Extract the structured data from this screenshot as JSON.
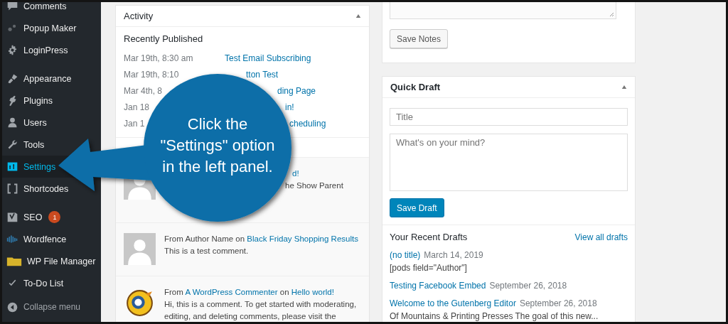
{
  "sidebar": {
    "groups": [
      {
        "items": [
          {
            "label": "Comments",
            "selected": false
          },
          {
            "label": "Popup Maker",
            "selected": false
          },
          {
            "label": "LoginPress",
            "selected": false
          }
        ]
      },
      {
        "items": [
          {
            "label": "Appearance",
            "selected": false
          },
          {
            "label": "Plugins",
            "selected": false
          },
          {
            "label": "Users",
            "selected": false
          },
          {
            "label": "Tools",
            "selected": false
          },
          {
            "label": "Settings",
            "selected": true
          },
          {
            "label": "Shortcodes",
            "selected": false
          }
        ]
      },
      {
        "items": [
          {
            "label": "SEO",
            "selected": false,
            "badge": "1"
          },
          {
            "label": "Wordfence",
            "selected": false
          },
          {
            "label": "WP File Manager",
            "selected": false
          },
          {
            "label": "To-Do List",
            "selected": false
          }
        ]
      }
    ],
    "collapse": {
      "label": "Collapse menu"
    }
  },
  "activity": {
    "title": "Activity",
    "section": "Recently Published",
    "published": [
      {
        "date": "Mar 19th, 8:30 am",
        "title": "Test Email Subscribing"
      },
      {
        "date": "Mar 19th, 8:10",
        "title": "tton Test"
      },
      {
        "date": "Mar 4th, 8",
        "title": "ding Page"
      },
      {
        "date": "Jan 18",
        "title": "in!"
      },
      {
        "date": "Jan 1",
        "title": "cheduling"
      }
    ],
    "comments": [
      {
        "kind": "default",
        "header": [
          {
            "text": "d!",
            "link": true
          }
        ],
        "body": "he Show Parent"
      },
      {
        "kind": "default",
        "header": [
          {
            "text": "From Author Name on",
            "link": false
          },
          {
            "text": "Black Friday Shopping Results",
            "link": true
          }
        ],
        "body": "This is a test comment."
      },
      {
        "kind": "mascot",
        "header": [
          {
            "text": "From",
            "link": false
          },
          {
            "text": "A WordPress Commenter",
            "link": true
          },
          {
            "text": "on",
            "link": false
          },
          {
            "text": "Hello world!",
            "link": true
          }
        ],
        "body": "Hi, this is a comment. To get started with moderating, editing, and deleting comments, please visit the"
      }
    ]
  },
  "notes": {
    "button": "Save Notes"
  },
  "quick_draft": {
    "title": "Quick Draft",
    "title_placeholder": "Title",
    "content_placeholder": "What's on your mind?",
    "button": "Save Draft",
    "recent_heading": "Your Recent Drafts",
    "view_all": "View all drafts",
    "drafts": [
      {
        "title": "(no title)",
        "date": "March 14, 2019",
        "excerpt": "[pods field=\"Author\"]"
      },
      {
        "title": "Testing Facebook Embed",
        "date": "September 26, 2018"
      },
      {
        "title": "Welcome to the Gutenberg Editor",
        "date": "September 26, 2018",
        "excerpt": "Of Mountains & Printing Presses The goal of this new..."
      }
    ]
  },
  "callout": {
    "text": "Click the\n\"Settings\" option\nin the left panel."
  }
}
